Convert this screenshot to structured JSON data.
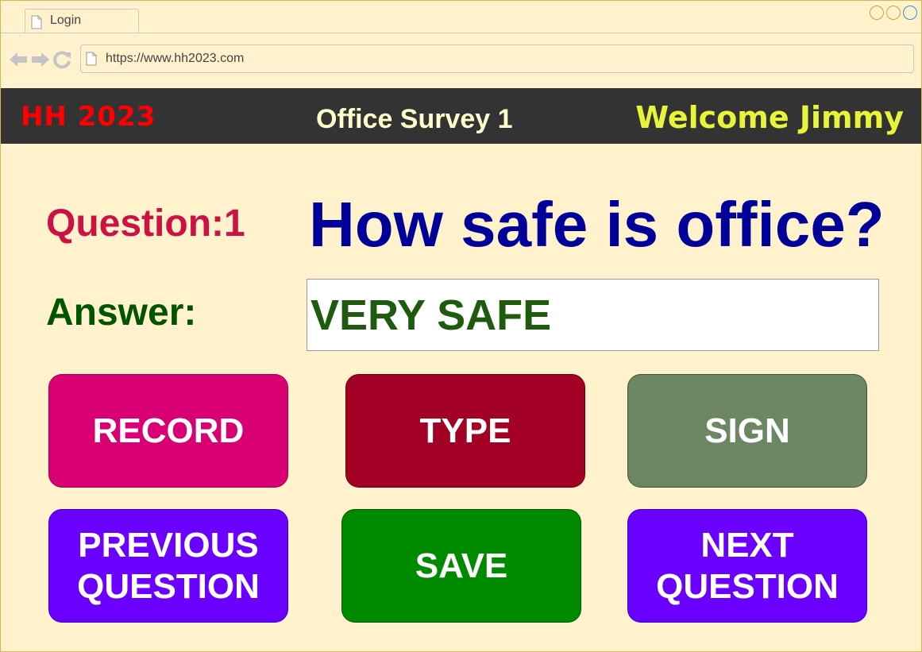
{
  "browser": {
    "tab_title": "Login",
    "url": "https://www.hh2023.com"
  },
  "header": {
    "logo": "HH 2023",
    "title": "Office Survey 1",
    "welcome": "Welcome Jimmy"
  },
  "question": {
    "label": "Question:1",
    "text": "How safe is office?"
  },
  "answer": {
    "label": "Answer:",
    "value": "VERY SAFE"
  },
  "buttons": {
    "record": "RECORD",
    "type": "TYPE",
    "sign": "SIGN",
    "previous": "PREVIOUS\nQUESTION",
    "save": "SAVE",
    "next": "NEXT\nQUESTION"
  },
  "colors": {
    "header_bg": "#333333",
    "logo": "#ff0000",
    "welcome": "#e6f53a",
    "question_label": "#cc1144",
    "question_text": "#000099",
    "answer": "#005500",
    "record": "#d80073",
    "type": "#a20025",
    "sign": "#6d8764",
    "nav_buttons": "#6a00ff",
    "save": "#008a00"
  }
}
